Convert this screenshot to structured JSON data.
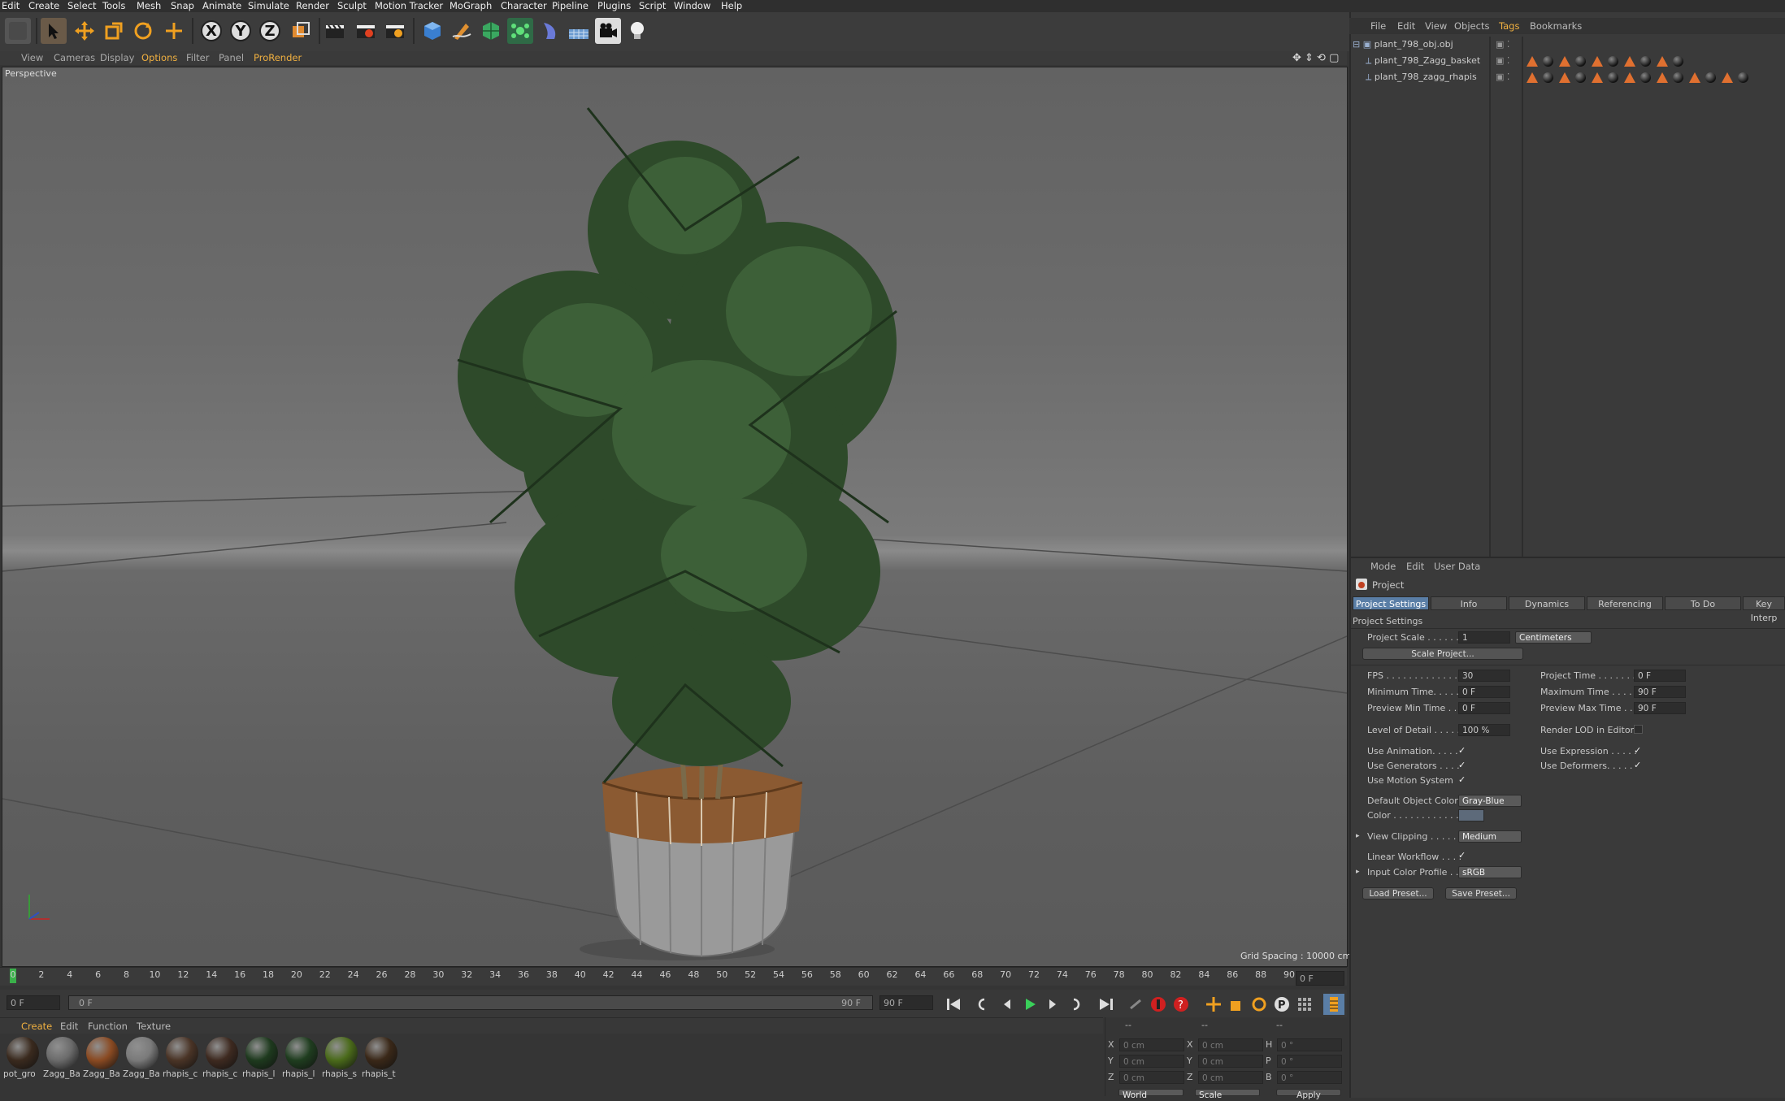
{
  "menubar": [
    "Edit",
    "Create",
    "Select",
    "Tools",
    "Mesh",
    "Snap",
    "Animate",
    "Simulate",
    "Render",
    "Sculpt",
    "Motion Tracker",
    "MoGraph",
    "Character",
    "Pipeline",
    "Plugins",
    "Script",
    "Window",
    "Help"
  ],
  "toolbar": {
    "x_label": "X",
    "y_label": "Y",
    "z_label": "Z",
    "icons": [
      "undo-icon",
      "select-arrow-icon",
      "move-icon",
      "scale-icon",
      "rotate-icon",
      "live-selection-icon",
      "axis-x-icon",
      "axis-y-icon",
      "axis-z-icon",
      "coordinate-system-icon",
      "render-view-icon",
      "render-picture-viewer-icon",
      "render-settings-icon",
      "cube-icon",
      "pen-icon",
      "subdivision-icon",
      "cloner-icon",
      "deformer-icon",
      "floor-icon",
      "camera-icon",
      "light-icon"
    ]
  },
  "viewport": {
    "menu": [
      "View",
      "Cameras",
      "Display",
      "Options",
      "Filter",
      "Panel",
      "ProRender"
    ],
    "label": "Perspective",
    "grid_spacing": "Grid Spacing : 10000 cm"
  },
  "timeline": {
    "ticks": [
      "0",
      "2",
      "4",
      "6",
      "8",
      "10",
      "12",
      "14",
      "16",
      "18",
      "20",
      "22",
      "24",
      "26",
      "28",
      "30",
      "32",
      "34",
      "36",
      "38",
      "40",
      "42",
      "44",
      "46",
      "48",
      "50",
      "52",
      "54",
      "56",
      "58",
      "60",
      "62",
      "64",
      "66",
      "68",
      "70",
      "72",
      "74",
      "76",
      "78",
      "80",
      "82",
      "84",
      "86",
      "88",
      "90"
    ],
    "current_frame": "0 F",
    "start_field": "0 F",
    "range_start": "0 F",
    "range_end": "90 F",
    "end_field": "90 F"
  },
  "materials": {
    "menu": [
      "Create",
      "Edit",
      "Function",
      "Texture"
    ],
    "items": [
      {
        "name": "pot_gro",
        "color": "#3a2a1e"
      },
      {
        "name": "Zagg_Ba",
        "color": "#6b6b6b"
      },
      {
        "name": "Zagg_Ba",
        "color": "#8a4a22"
      },
      {
        "name": "Zagg_Ba",
        "color": "#7a7a7a"
      },
      {
        "name": "rhapis_c",
        "color": "#4a3426"
      },
      {
        "name": "rhapis_c",
        "color": "#3e2a20"
      },
      {
        "name": "rhapis_l",
        "color": "#1e3a1e"
      },
      {
        "name": "rhapis_l",
        "color": "#1f3d1f"
      },
      {
        "name": "rhapis_s",
        "color": "#4a6a1a"
      },
      {
        "name": "rhapis_t",
        "color": "#3a2818"
      }
    ]
  },
  "coords": {
    "headers": [
      "--",
      "--",
      "--"
    ],
    "rows": [
      {
        "a": "X",
        "av": "0 cm",
        "b": "X",
        "bv": "0 cm",
        "c": "H",
        "cv": "0 °"
      },
      {
        "a": "Y",
        "av": "0 cm",
        "b": "Y",
        "bv": "0 cm",
        "c": "P",
        "cv": "0 °"
      },
      {
        "a": "Z",
        "av": "0 cm",
        "b": "Z",
        "bv": "0 cm",
        "c": "B",
        "cv": "0 °"
      }
    ],
    "world": "World",
    "scale": "Scale",
    "apply": "Apply"
  },
  "objects": {
    "menu": [
      "File",
      "Edit",
      "View",
      "Objects",
      "Tags",
      "Bookmarks"
    ],
    "active_menu": "Tags",
    "rows": [
      {
        "name": "plant_798_obj.obj",
        "tags": 0
      },
      {
        "name": "plant_798_Zagg_basket",
        "tags": 5
      },
      {
        "name": "plant_798_zagg_rhapis",
        "tags": 7
      }
    ]
  },
  "attributes": {
    "menu": [
      "Mode",
      "Edit",
      "User Data"
    ],
    "title": "Project",
    "tabs": [
      "Project Settings",
      "Info",
      "Dynamics",
      "Referencing",
      "To Do",
      "Key Interp"
    ],
    "section": "Project Settings",
    "project_scale_label": "Project Scale . . . . . .",
    "project_scale_value": "1",
    "project_scale_unit": "Centimeters",
    "scale_project_button": "Scale Project...",
    "fps_label": "FPS . . . . . . . . . . . . . .",
    "fps_value": "30",
    "project_time_label": "Project Time . . . . . . . .",
    "project_time_value": "0 F",
    "min_time_label": "Minimum Time. . . . . .",
    "min_time_value": "0 F",
    "max_time_label": "Maximum Time . . . . .",
    "max_time_value": "90 F",
    "prev_min_label": "Preview Min Time . . .",
    "prev_min_value": "0 F",
    "prev_max_label": "Preview Max Time . . .",
    "prev_max_value": "90 F",
    "lod_label": "Level of Detail . . . . .",
    "lod_value": "100 %",
    "render_lod_label": "Render LOD in Editor",
    "use_animation_label": "Use Animation. . . . .",
    "use_expression_label": "Use Expression . . . . .",
    "use_generators_label": "Use Generators . . . .",
    "use_deformers_label": "Use Deformers. . . . .",
    "use_motion_label": "Use Motion System",
    "default_color_label": "Default Object Color",
    "default_color_value": "Gray-Blue",
    "color_label": "Color . . . . . . . . . . . .",
    "view_clipping_label": "View Clipping . . . . . .",
    "view_clipping_value": "Medium",
    "linear_workflow_label": "Linear Workflow . . . .",
    "input_profile_label": "Input Color Profile . .",
    "input_profile_value": "sRGB",
    "load_preset": "Load Preset...",
    "save_preset": "Save Preset...",
    "check": "✓"
  }
}
